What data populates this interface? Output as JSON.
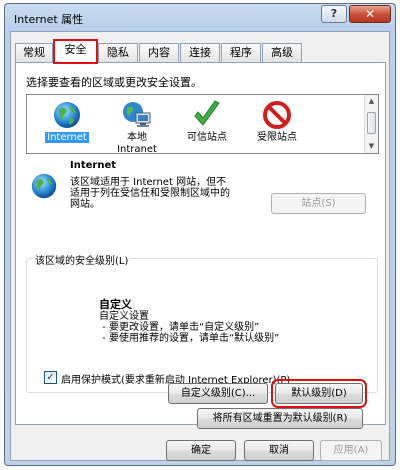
{
  "window": {
    "title": "Internet 属性",
    "help_label": "?",
    "close_label": "✕"
  },
  "tabs": [
    {
      "label": "常规"
    },
    {
      "label": "安全"
    },
    {
      "label": "隐私"
    },
    {
      "label": "内容"
    },
    {
      "label": "连接"
    },
    {
      "label": "程序"
    },
    {
      "label": "高级"
    }
  ],
  "security": {
    "instruction": "选择要查看的区域或更改安全设置。",
    "zones": [
      {
        "label": "Internet",
        "icon": "globe-icon",
        "selected": true
      },
      {
        "label": "本地\nIntranet",
        "icon": "local-intranet-icon"
      },
      {
        "label": "可信站点",
        "icon": "checkmark-icon"
      },
      {
        "label": "受限站点",
        "icon": "no-entry-icon"
      }
    ],
    "zone_info": {
      "title": "Internet",
      "description": "该区域适用于 Internet 网站，但不适用于列在受信任和受限制区域中的网站。"
    },
    "sites_button": "站点(S)",
    "level_group": {
      "title": "该区域的安全级别(L)",
      "level_name": "自定义",
      "level_desc": "自定义设置\n - 要更改设置，请单击“自定义级别”\n - 要使用推荐的设置，请单击“默认级别”"
    },
    "protected_mode": {
      "label": "启用保护模式(要求重新启动 Internet Explorer)(P)",
      "checked": true,
      "mark": "✓"
    },
    "custom_level_button": "自定义级别(C)...",
    "default_level_button": "默认级别(D)",
    "reset_all_button": "将所有区域重置为默认级别(R)"
  },
  "footer": {
    "ok": "确定",
    "cancel": "取消",
    "apply": "应用(A)"
  },
  "colors": {
    "highlight_red": "#e01010",
    "selection_blue": "#3399ff"
  }
}
